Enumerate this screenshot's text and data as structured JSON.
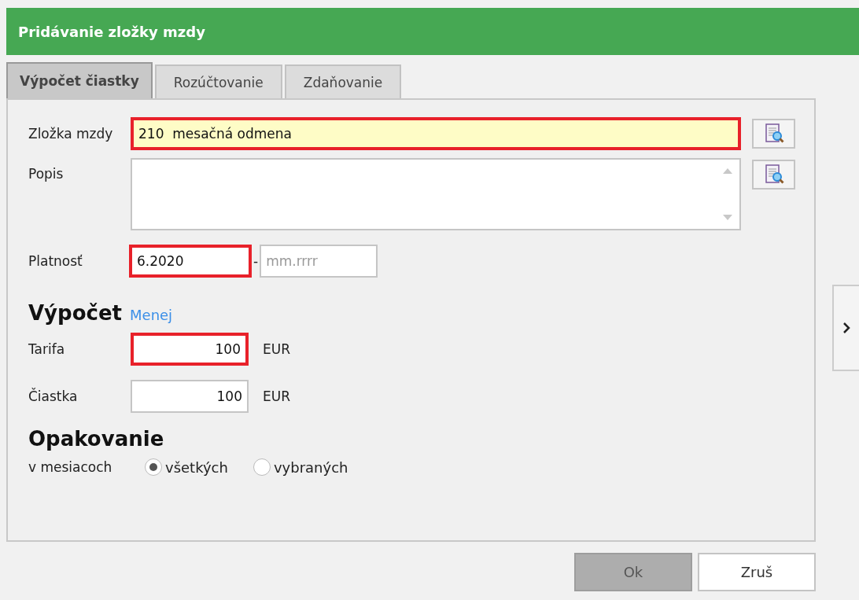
{
  "window": {
    "title": "Pridávanie zložky mzdy"
  },
  "tabs": [
    {
      "label": "Výpočet čiastky",
      "selected": true
    },
    {
      "label": "Rozúčtovanie",
      "selected": false
    },
    {
      "label": "Zdaňovanie",
      "selected": false
    }
  ],
  "wage_component": {
    "label": "Zložka mzdy",
    "value": "210  mesačná odmena",
    "invalid": true
  },
  "description": {
    "label": "Popis"
  },
  "validity": {
    "label": "Platnosť",
    "from": {
      "value": "6.2020",
      "invalid": true
    },
    "separator": "-",
    "to": {
      "placeholder": "mm.rrrr",
      "invalid": false
    }
  },
  "calculation": {
    "heading": "Výpočet",
    "toggle_link": "Menej",
    "fields": [
      {
        "label": "Tarifa",
        "value": "100",
        "unit": "EUR",
        "invalid": true
      },
      {
        "label": "Čiastka",
        "value": "100",
        "unit": "EUR",
        "invalid": false
      }
    ]
  },
  "repetition": {
    "heading": "Opakovanie",
    "label": "v mesiacoch",
    "options": [
      {
        "label": "všetkých",
        "selected": true
      },
      {
        "label": "vybraných",
        "selected": false
      }
    ]
  },
  "buttons": [
    {
      "label": "Ok",
      "disabled": true
    },
    {
      "label": "Zruš",
      "disabled": false
    }
  ]
}
